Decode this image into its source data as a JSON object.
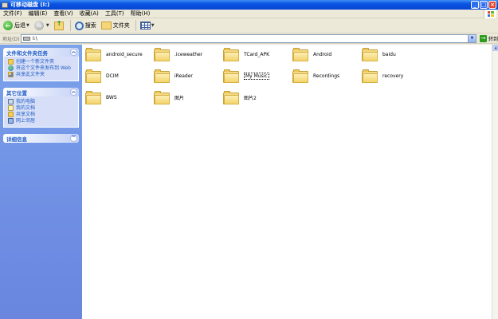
{
  "window": {
    "title": "可移动磁盘 (I:)"
  },
  "menubar": {
    "items": [
      "文件(F)",
      "编辑(E)",
      "查看(V)",
      "收藏(A)",
      "工具(T)",
      "帮助(H)"
    ]
  },
  "toolbar": {
    "back_label": "后退",
    "search_label": "搜索",
    "folders_label": "文件夹"
  },
  "address": {
    "label": "地址(D)",
    "value": "I:\\",
    "go_label": "转到"
  },
  "taskpane": {
    "file_tasks": {
      "title": "文件和文件夹任务",
      "items": [
        {
          "label": "创建一个新文件夹",
          "icon": "new-folder-icon"
        },
        {
          "label": "将这个文件夹发布到 Web",
          "icon": "publish-web-icon"
        },
        {
          "label": "共享此文件夹",
          "icon": "share-folder-icon"
        }
      ]
    },
    "other_places": {
      "title": "其它位置",
      "items": [
        {
          "label": "我的电脑",
          "icon": "my-computer-icon"
        },
        {
          "label": "我的文档",
          "icon": "my-documents-icon"
        },
        {
          "label": "共享文档",
          "icon": "shared-documents-icon"
        },
        {
          "label": "网上邻居",
          "icon": "network-places-icon"
        }
      ]
    },
    "details": {
      "title": "详细信息"
    }
  },
  "files": [
    {
      "name": "android_secure"
    },
    {
      "name": ".iceweather"
    },
    {
      "name": "TCard_APK"
    },
    {
      "name": "Android"
    },
    {
      "name": "baidu"
    },
    {
      "name": "DCIM"
    },
    {
      "name": "iReader"
    },
    {
      "name": "My Music",
      "selected": true
    },
    {
      "name": "Recordings"
    },
    {
      "name": "recovery"
    },
    {
      "name": "BWS"
    },
    {
      "name": "图片"
    },
    {
      "name": "图片2"
    }
  ]
}
